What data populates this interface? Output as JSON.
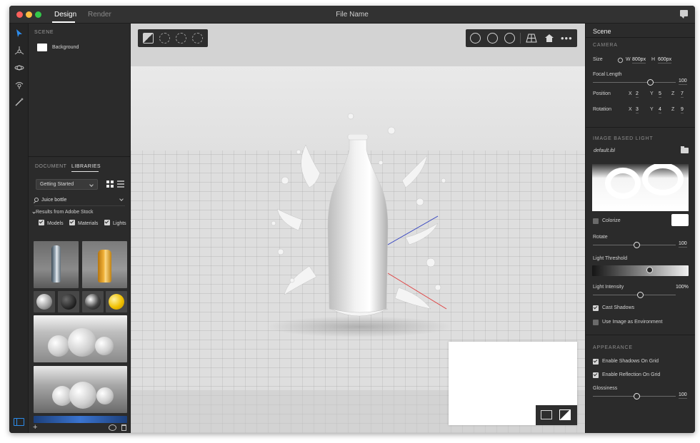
{
  "titlebar": {
    "tabs": [
      {
        "label": "Design",
        "active": true
      },
      {
        "label": "Render",
        "active": false
      }
    ],
    "file_name": "File Name",
    "icons": {
      "feedback": "chat-bubble-icon"
    }
  },
  "toolbar": {
    "tools": [
      "select-arrow-icon",
      "move-gizmo-icon",
      "orbit-gizmo-icon",
      "sample-eyedropper-icon",
      "magic-wand-icon"
    ],
    "bottom": "panel-toggle-icon"
  },
  "scene_panel": {
    "header": "SCENE",
    "items": [
      {
        "label": "Background",
        "swatch": "#ffffff"
      }
    ]
  },
  "libraries": {
    "tabs": [
      {
        "label": "DOCUMENT",
        "active": false
      },
      {
        "label": "LIBRARIES",
        "active": true
      }
    ],
    "library_select": "Getting Started",
    "search_value": "Juice bottle",
    "results_label": "Results from Adobe Stock",
    "filters": [
      {
        "label": "Models",
        "checked": true
      },
      {
        "label": "Materials",
        "checked": true
      },
      {
        "label": "Lights",
        "checked": true
      }
    ]
  },
  "viewport": {
    "left_tools": [
      "material-picker-icon",
      "selection-circle-icon",
      "add-selection-icon",
      "subtract-selection-icon"
    ],
    "right_tools": [
      "orbit-camera-icon",
      "pan-camera-icon",
      "dolly-camera-icon",
      "perspective-grid-icon",
      "home-icon",
      "more-icon"
    ],
    "preview_tools": [
      "render-preview-icon",
      "preview-size-icon"
    ]
  },
  "properties": {
    "title": "Scene",
    "camera": {
      "header": "CAMERA",
      "size_label": "Size",
      "width_label": "W",
      "width_value": "800px",
      "height_label": "H",
      "height_value": "600px",
      "focal_label": "Focal Length",
      "focal_value": "100",
      "position_label": "Position",
      "position": {
        "x": "2",
        "y": "5",
        "z": "7"
      },
      "rotation_label": "Rotation",
      "rotation": {
        "x": "3",
        "y": "4",
        "z": "9"
      },
      "axis_x": "X",
      "axis_y": "Y",
      "axis_z": "Z"
    },
    "ibl": {
      "header": "IMAGE BASED LIGHT",
      "file": "default.ibl",
      "colorize_label": "Colorize",
      "colorize_checked": false,
      "colorize_color": "#ffffff",
      "rotate_label": "Rotate",
      "rotate_value": "100",
      "threshold_label": "Light Threshold",
      "threshold_level": 0.6,
      "intensity_label": "Light Intensity",
      "intensity_value": "100%",
      "cast_shadows_label": "Cast Shadows",
      "cast_shadows_checked": true,
      "use_env_label": "Use Image as Environment",
      "use_env_checked": false
    },
    "appearance": {
      "header": "APPEARANCE",
      "shadows_label": "Enable Shadows On Grid",
      "shadows_checked": true,
      "reflection_label": "Enable Reflection On Grid",
      "reflection_checked": true,
      "glossiness_label": "Glossiness",
      "glossiness_value": "100"
    }
  },
  "colors": {
    "accent": "#2d8ceb",
    "panel_bg": "#2b2b2b",
    "viewport_bg": "#e2e2e2"
  }
}
